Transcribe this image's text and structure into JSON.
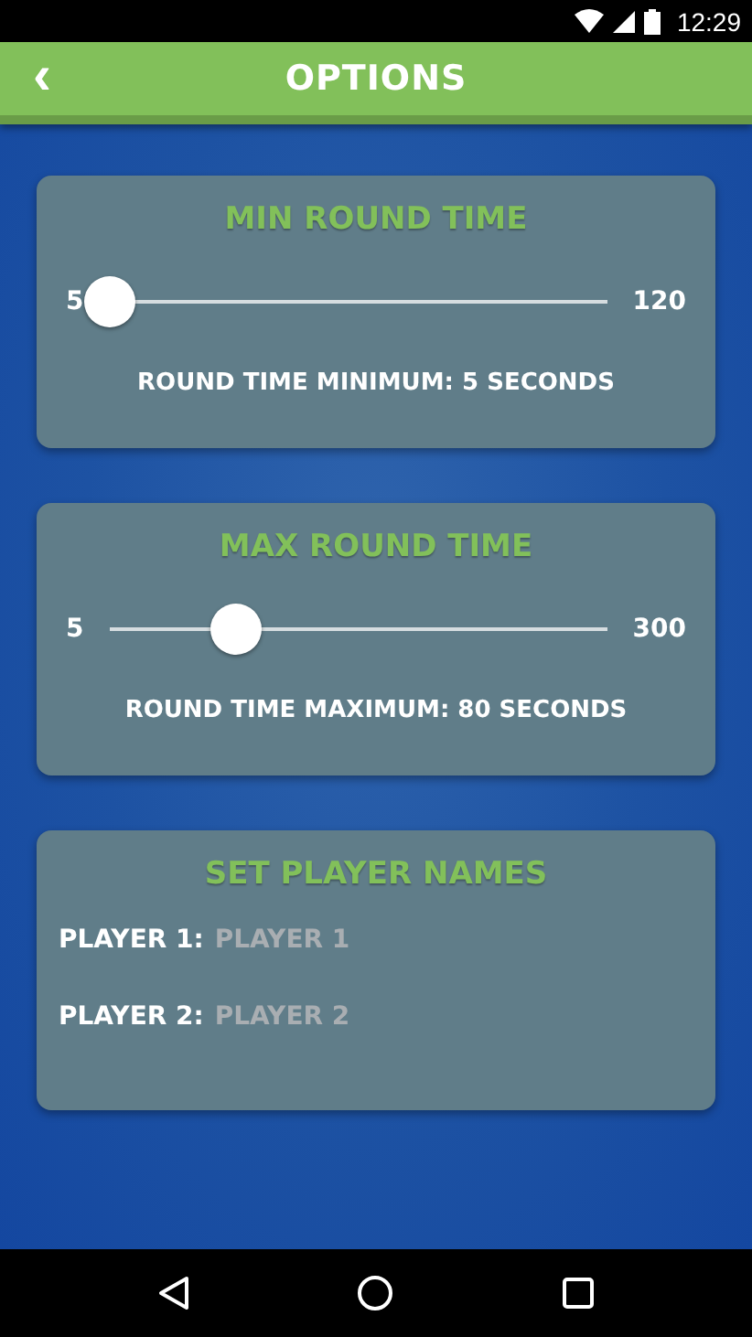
{
  "status_bar": {
    "time": "12:29"
  },
  "app_bar": {
    "back_label": "‹",
    "title": "OPTIONS"
  },
  "sliders": [
    {
      "title": "MIN ROUND TIME",
      "min_label": "5",
      "max_label": "120",
      "level": 0,
      "caption": "ROUND TIME MINIMUM: 5 SECONDS"
    },
    {
      "title": "MAX ROUND TIME",
      "min_label": "5",
      "max_label": "300",
      "level": 0.254,
      "caption": "ROUND TIME MAXIMUM: 80 SECONDS"
    }
  ],
  "player_names": {
    "title": "SET PLAYER NAMES",
    "fields": [
      {
        "label": "PLAYER 1:",
        "placeholder": "PLAYER 1"
      },
      {
        "label": "PLAYER 2:",
        "placeholder": "PLAYER 2"
      }
    ]
  }
}
